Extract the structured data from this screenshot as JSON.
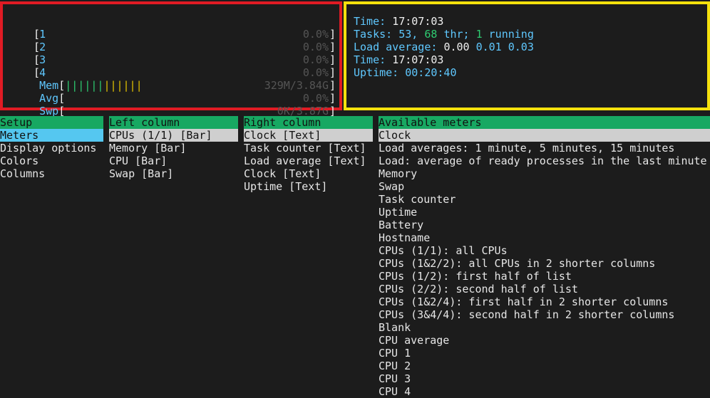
{
  "cpu_meters": [
    {
      "label": "1",
      "value": "0.0%"
    },
    {
      "label": "2",
      "value": "0.0%"
    },
    {
      "label": "3",
      "value": "0.0%"
    },
    {
      "label": "4",
      "value": "0.0%"
    }
  ],
  "mem_meter": {
    "label": "Mem",
    "bar_green": "||||||",
    "bar_yellow": "||||||",
    "value": "329M/3.84G"
  },
  "avg_meter": {
    "label": "Avg",
    "value": "0.0%"
  },
  "swp_meter": {
    "label": "Swp",
    "value": "0K/3.87G"
  },
  "right_meters": {
    "time1_label": "Time:",
    "time1_value": "17:07:03",
    "tasks_label": "Tasks:",
    "tasks_count": "53,",
    "tasks_thr": "68",
    "tasks_thr_label": "thr;",
    "tasks_running": "1",
    "tasks_running_label": "running",
    "load_label": "Load average:",
    "load1": "0.00",
    "load5": "0.01",
    "load15": "0.03",
    "time2_label": "Time:",
    "time2_value": "17:07:03",
    "uptime_label": "Uptime:",
    "uptime_value": "00:20:40"
  },
  "setup": {
    "header": "Setup",
    "items": [
      "Meters",
      "Display options",
      "Colors",
      "Columns"
    ]
  },
  "left_column": {
    "header": "Left column",
    "items": [
      "CPUs (1/1) [Bar]",
      "Memory [Bar]",
      "CPU [Bar]",
      "Swap [Bar]"
    ]
  },
  "right_column": {
    "header": "Right column",
    "items": [
      "Clock [Text]",
      "Task counter [Text]",
      "Load average [Text]",
      "Clock [Text]",
      "Uptime [Text]"
    ]
  },
  "available_meters": {
    "header": "Available meters",
    "items": [
      "Clock",
      "Load averages: 1 minute, 5 minutes, 15 minutes",
      "Load: average of ready processes in the last minute",
      "Memory",
      "Swap",
      "Task counter",
      "Uptime",
      "Battery",
      "Hostname",
      "CPUs (1/1): all CPUs",
      "CPUs (1&2/2): all CPUs in 2 shorter columns",
      "CPUs (1/2): first half of list",
      "CPUs (2/2): second half of list",
      "CPUs (1&2/4): first half in 2 shorter columns",
      "CPUs (3&4/4): second half in 2 shorter columns",
      "Blank",
      "CPU average",
      "CPU 1",
      "CPU 2",
      "CPU 3",
      "CPU 4"
    ]
  },
  "colors": {
    "left_highlight_border": "#e01b24",
    "right_highlight_border": "#f5e10d",
    "header_green": "#17a862",
    "selected_cyan": "#55c7f0",
    "selected_gray": "#cfcfcf"
  }
}
